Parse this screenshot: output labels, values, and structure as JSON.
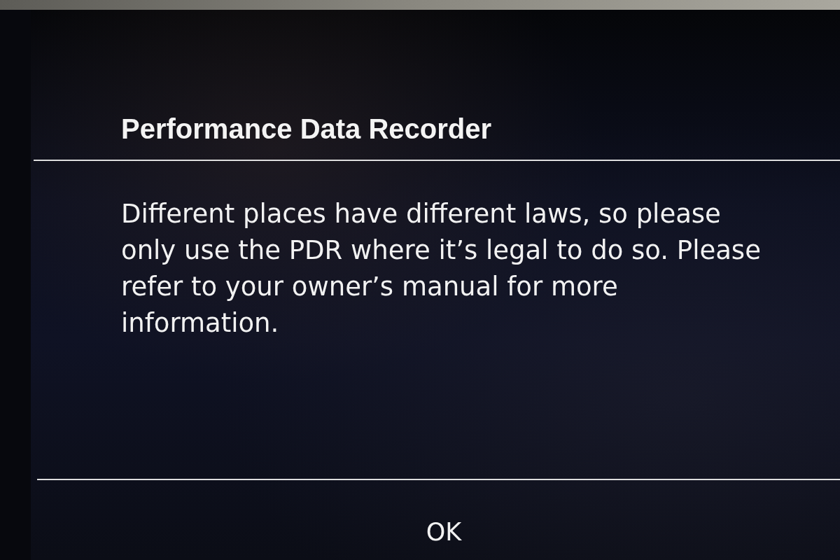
{
  "dialog": {
    "title": "Performance Data Recorder",
    "message": "Different places have different laws, so please only use the PDR where it’s legal to do so. Please refer to your owner’s manual for more information.",
    "buttons": [
      "OK"
    ]
  }
}
